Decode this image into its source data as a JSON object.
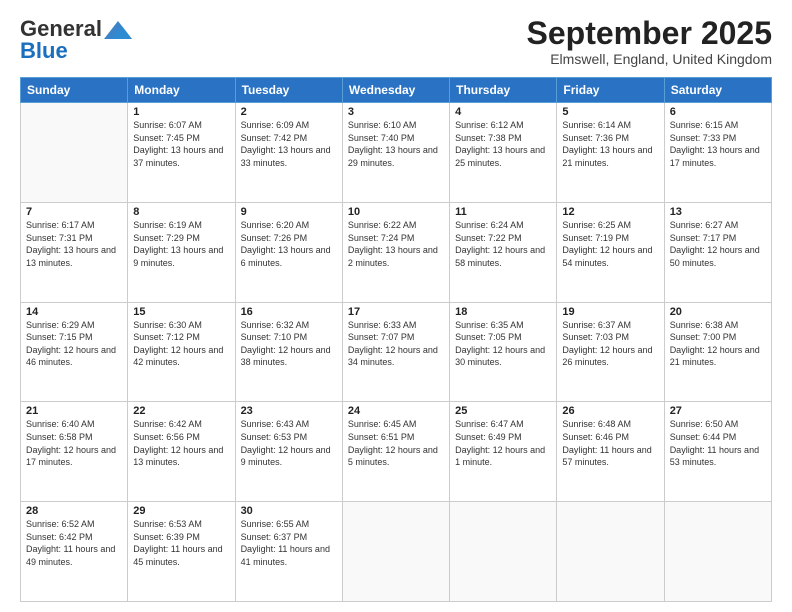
{
  "header": {
    "logo_general": "General",
    "logo_blue": "Blue",
    "month_title": "September 2025",
    "location": "Elmswell, England, United Kingdom"
  },
  "days_of_week": [
    "Sunday",
    "Monday",
    "Tuesday",
    "Wednesday",
    "Thursday",
    "Friday",
    "Saturday"
  ],
  "weeks": [
    [
      {
        "day": "",
        "sunrise": "",
        "sunset": "",
        "daylight": ""
      },
      {
        "day": "1",
        "sunrise": "Sunrise: 6:07 AM",
        "sunset": "Sunset: 7:45 PM",
        "daylight": "Daylight: 13 hours and 37 minutes."
      },
      {
        "day": "2",
        "sunrise": "Sunrise: 6:09 AM",
        "sunset": "Sunset: 7:42 PM",
        "daylight": "Daylight: 13 hours and 33 minutes."
      },
      {
        "day": "3",
        "sunrise": "Sunrise: 6:10 AM",
        "sunset": "Sunset: 7:40 PM",
        "daylight": "Daylight: 13 hours and 29 minutes."
      },
      {
        "day": "4",
        "sunrise": "Sunrise: 6:12 AM",
        "sunset": "Sunset: 7:38 PM",
        "daylight": "Daylight: 13 hours and 25 minutes."
      },
      {
        "day": "5",
        "sunrise": "Sunrise: 6:14 AM",
        "sunset": "Sunset: 7:36 PM",
        "daylight": "Daylight: 13 hours and 21 minutes."
      },
      {
        "day": "6",
        "sunrise": "Sunrise: 6:15 AM",
        "sunset": "Sunset: 7:33 PM",
        "daylight": "Daylight: 13 hours and 17 minutes."
      }
    ],
    [
      {
        "day": "7",
        "sunrise": "Sunrise: 6:17 AM",
        "sunset": "Sunset: 7:31 PM",
        "daylight": "Daylight: 13 hours and 13 minutes."
      },
      {
        "day": "8",
        "sunrise": "Sunrise: 6:19 AM",
        "sunset": "Sunset: 7:29 PM",
        "daylight": "Daylight: 13 hours and 9 minutes."
      },
      {
        "day": "9",
        "sunrise": "Sunrise: 6:20 AM",
        "sunset": "Sunset: 7:26 PM",
        "daylight": "Daylight: 13 hours and 6 minutes."
      },
      {
        "day": "10",
        "sunrise": "Sunrise: 6:22 AM",
        "sunset": "Sunset: 7:24 PM",
        "daylight": "Daylight: 13 hours and 2 minutes."
      },
      {
        "day": "11",
        "sunrise": "Sunrise: 6:24 AM",
        "sunset": "Sunset: 7:22 PM",
        "daylight": "Daylight: 12 hours and 58 minutes."
      },
      {
        "day": "12",
        "sunrise": "Sunrise: 6:25 AM",
        "sunset": "Sunset: 7:19 PM",
        "daylight": "Daylight: 12 hours and 54 minutes."
      },
      {
        "day": "13",
        "sunrise": "Sunrise: 6:27 AM",
        "sunset": "Sunset: 7:17 PM",
        "daylight": "Daylight: 12 hours and 50 minutes."
      }
    ],
    [
      {
        "day": "14",
        "sunrise": "Sunrise: 6:29 AM",
        "sunset": "Sunset: 7:15 PM",
        "daylight": "Daylight: 12 hours and 46 minutes."
      },
      {
        "day": "15",
        "sunrise": "Sunrise: 6:30 AM",
        "sunset": "Sunset: 7:12 PM",
        "daylight": "Daylight: 12 hours and 42 minutes."
      },
      {
        "day": "16",
        "sunrise": "Sunrise: 6:32 AM",
        "sunset": "Sunset: 7:10 PM",
        "daylight": "Daylight: 12 hours and 38 minutes."
      },
      {
        "day": "17",
        "sunrise": "Sunrise: 6:33 AM",
        "sunset": "Sunset: 7:07 PM",
        "daylight": "Daylight: 12 hours and 34 minutes."
      },
      {
        "day": "18",
        "sunrise": "Sunrise: 6:35 AM",
        "sunset": "Sunset: 7:05 PM",
        "daylight": "Daylight: 12 hours and 30 minutes."
      },
      {
        "day": "19",
        "sunrise": "Sunrise: 6:37 AM",
        "sunset": "Sunset: 7:03 PM",
        "daylight": "Daylight: 12 hours and 26 minutes."
      },
      {
        "day": "20",
        "sunrise": "Sunrise: 6:38 AM",
        "sunset": "Sunset: 7:00 PM",
        "daylight": "Daylight: 12 hours and 21 minutes."
      }
    ],
    [
      {
        "day": "21",
        "sunrise": "Sunrise: 6:40 AM",
        "sunset": "Sunset: 6:58 PM",
        "daylight": "Daylight: 12 hours and 17 minutes."
      },
      {
        "day": "22",
        "sunrise": "Sunrise: 6:42 AM",
        "sunset": "Sunset: 6:56 PM",
        "daylight": "Daylight: 12 hours and 13 minutes."
      },
      {
        "day": "23",
        "sunrise": "Sunrise: 6:43 AM",
        "sunset": "Sunset: 6:53 PM",
        "daylight": "Daylight: 12 hours and 9 minutes."
      },
      {
        "day": "24",
        "sunrise": "Sunrise: 6:45 AM",
        "sunset": "Sunset: 6:51 PM",
        "daylight": "Daylight: 12 hours and 5 minutes."
      },
      {
        "day": "25",
        "sunrise": "Sunrise: 6:47 AM",
        "sunset": "Sunset: 6:49 PM",
        "daylight": "Daylight: 12 hours and 1 minute."
      },
      {
        "day": "26",
        "sunrise": "Sunrise: 6:48 AM",
        "sunset": "Sunset: 6:46 PM",
        "daylight": "Daylight: 11 hours and 57 minutes."
      },
      {
        "day": "27",
        "sunrise": "Sunrise: 6:50 AM",
        "sunset": "Sunset: 6:44 PM",
        "daylight": "Daylight: 11 hours and 53 minutes."
      }
    ],
    [
      {
        "day": "28",
        "sunrise": "Sunrise: 6:52 AM",
        "sunset": "Sunset: 6:42 PM",
        "daylight": "Daylight: 11 hours and 49 minutes."
      },
      {
        "day": "29",
        "sunrise": "Sunrise: 6:53 AM",
        "sunset": "Sunset: 6:39 PM",
        "daylight": "Daylight: 11 hours and 45 minutes."
      },
      {
        "day": "30",
        "sunrise": "Sunrise: 6:55 AM",
        "sunset": "Sunset: 6:37 PM",
        "daylight": "Daylight: 11 hours and 41 minutes."
      },
      {
        "day": "",
        "sunrise": "",
        "sunset": "",
        "daylight": ""
      },
      {
        "day": "",
        "sunrise": "",
        "sunset": "",
        "daylight": ""
      },
      {
        "day": "",
        "sunrise": "",
        "sunset": "",
        "daylight": ""
      },
      {
        "day": "",
        "sunrise": "",
        "sunset": "",
        "daylight": ""
      }
    ]
  ]
}
